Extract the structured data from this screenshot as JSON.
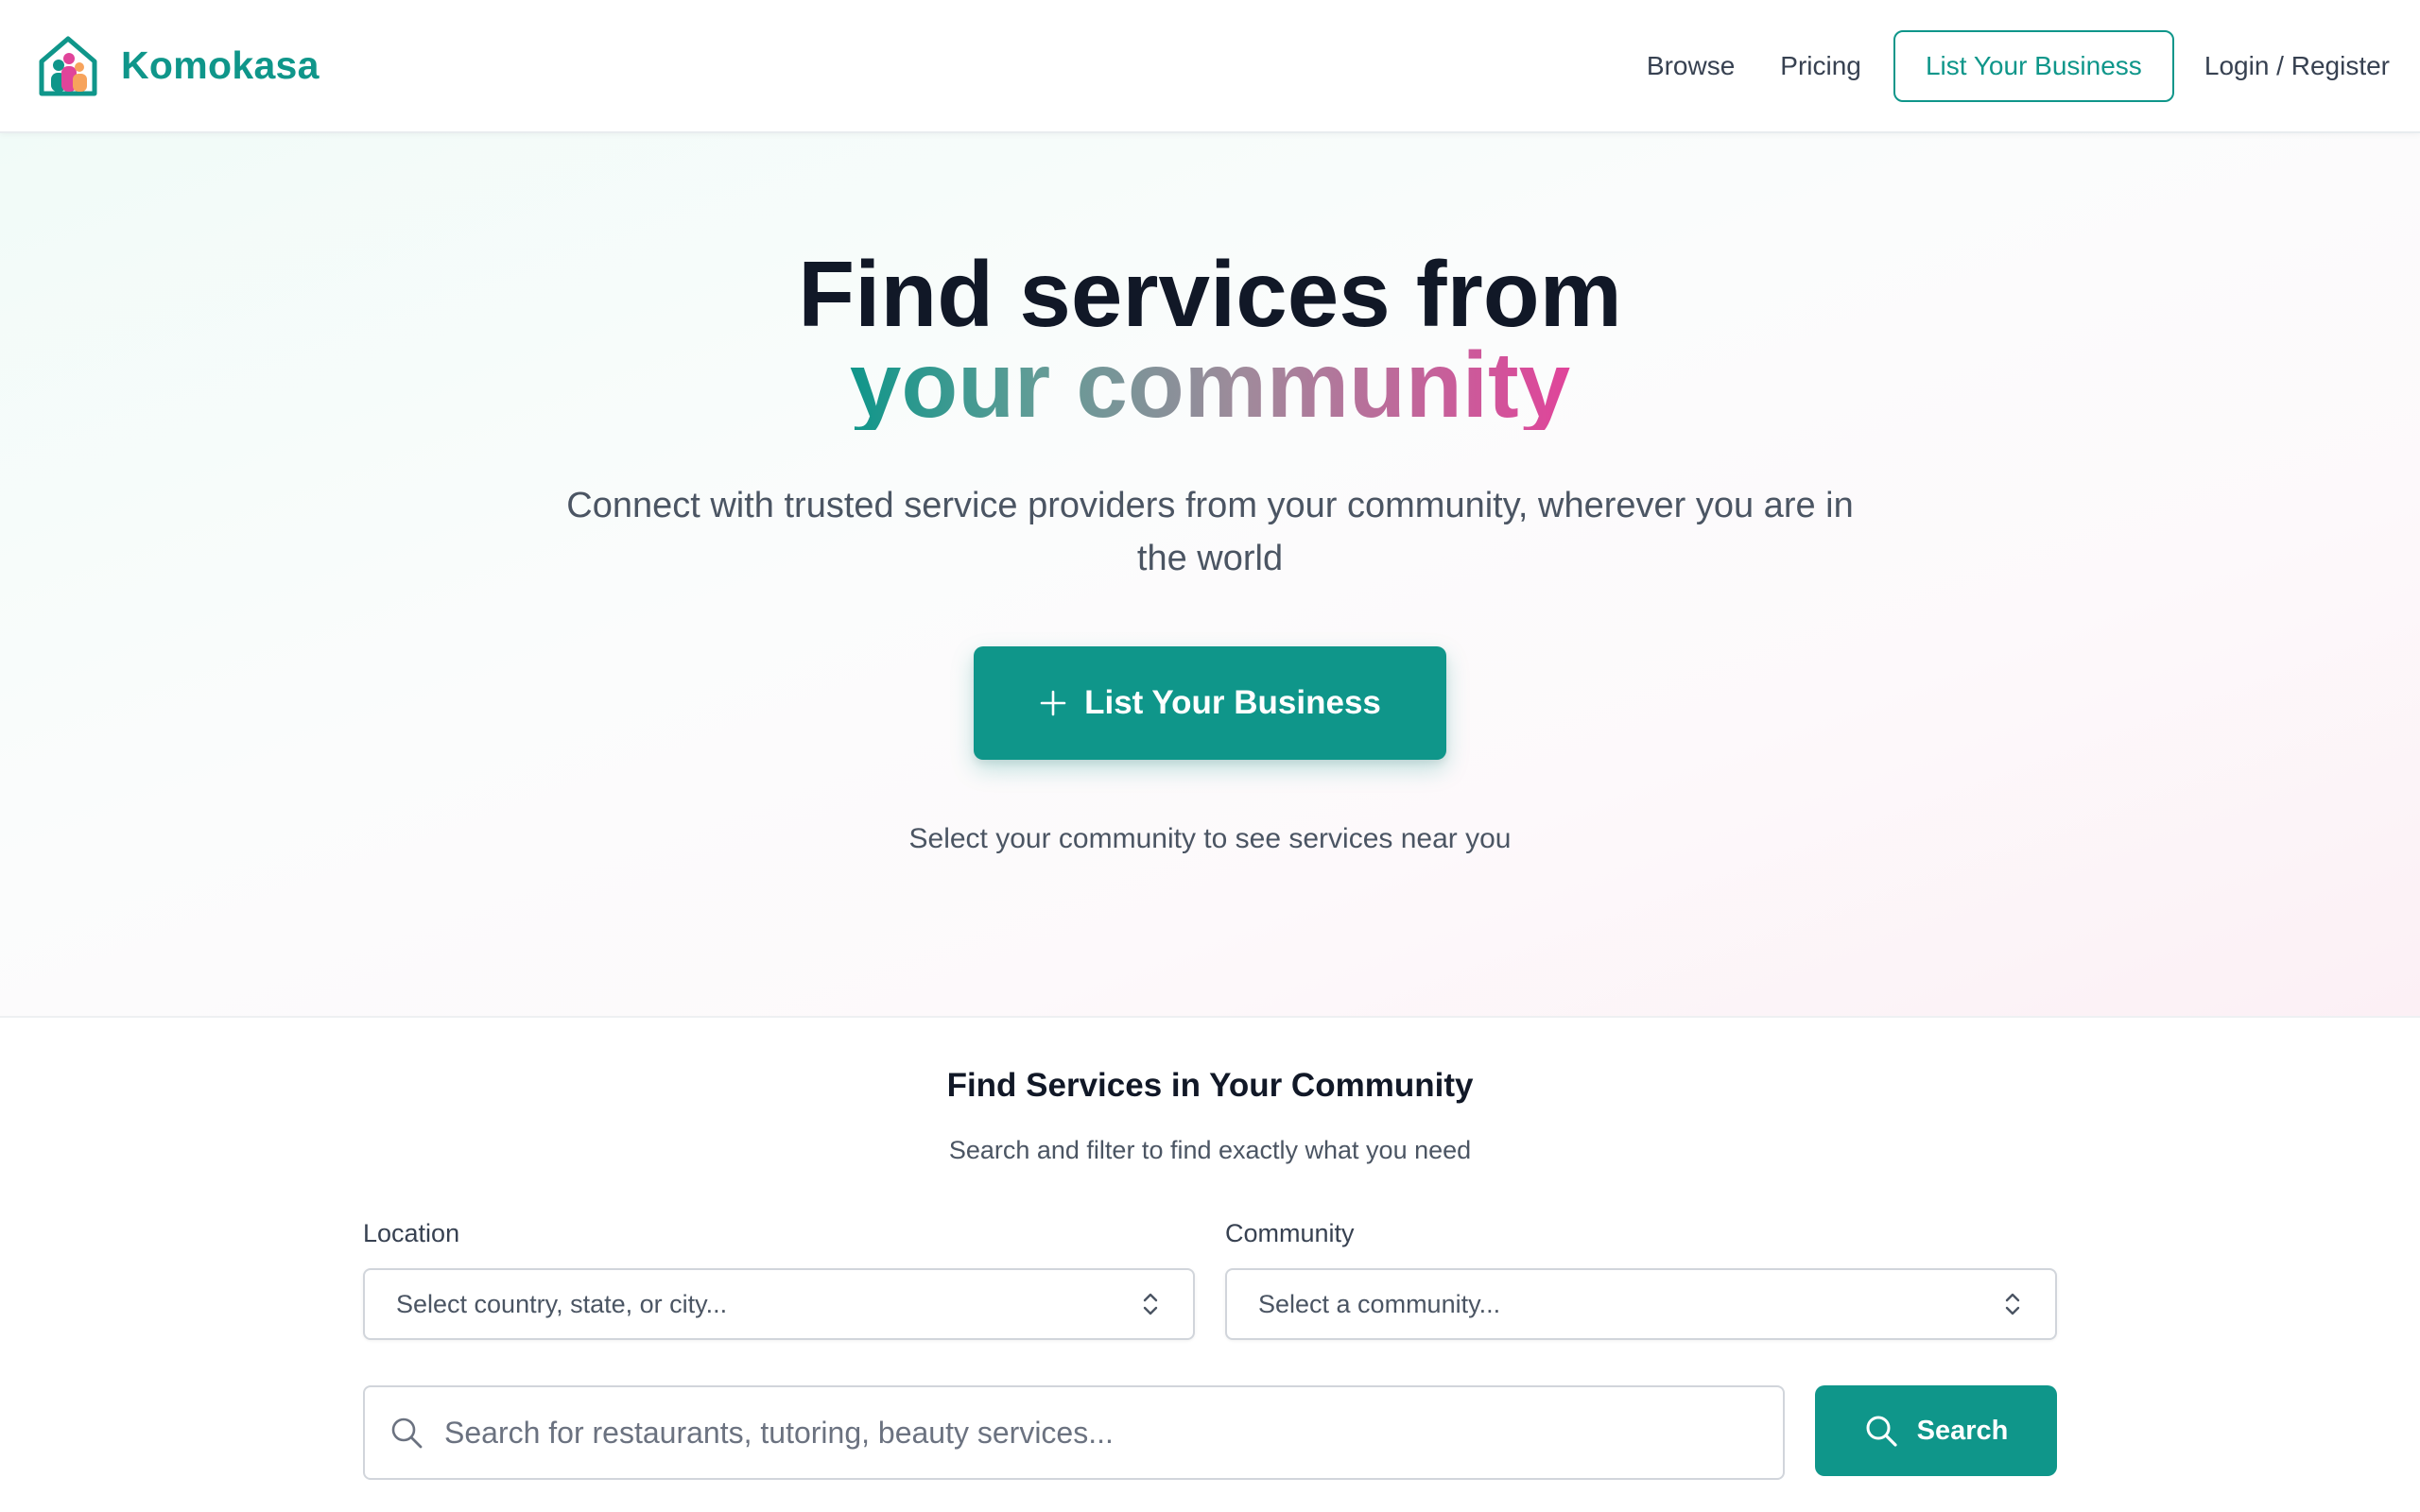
{
  "brand": {
    "name": "Komokasa",
    "icon": "house-family-logo-icon"
  },
  "nav": {
    "browse": "Browse",
    "pricing": "Pricing",
    "list_business": "List Your Business",
    "login": "Login / Register"
  },
  "hero": {
    "title_line1": "Find services from",
    "title_line2": "your community",
    "subtitle": "Connect with trusted service providers from your community, wherever you are in the world",
    "cta_label": "List Your Business",
    "cta_icon": "plus-icon",
    "hint": "Select your community to see services near you"
  },
  "search_section": {
    "title": "Find Services in Your Community",
    "subtitle": "Search and filter to find exactly what you need",
    "location": {
      "label": "Location",
      "placeholder": "Select country, state, or city..."
    },
    "community": {
      "label": "Community",
      "placeholder": "Select a community..."
    },
    "search": {
      "placeholder": "Search for restaurants, tutoring, beauty services...",
      "button_label": "Search"
    }
  },
  "colors": {
    "accent": "#0f968a",
    "gradient_pink": "#e0449a",
    "text_dark": "#111827",
    "text_muted": "#4b5563"
  }
}
